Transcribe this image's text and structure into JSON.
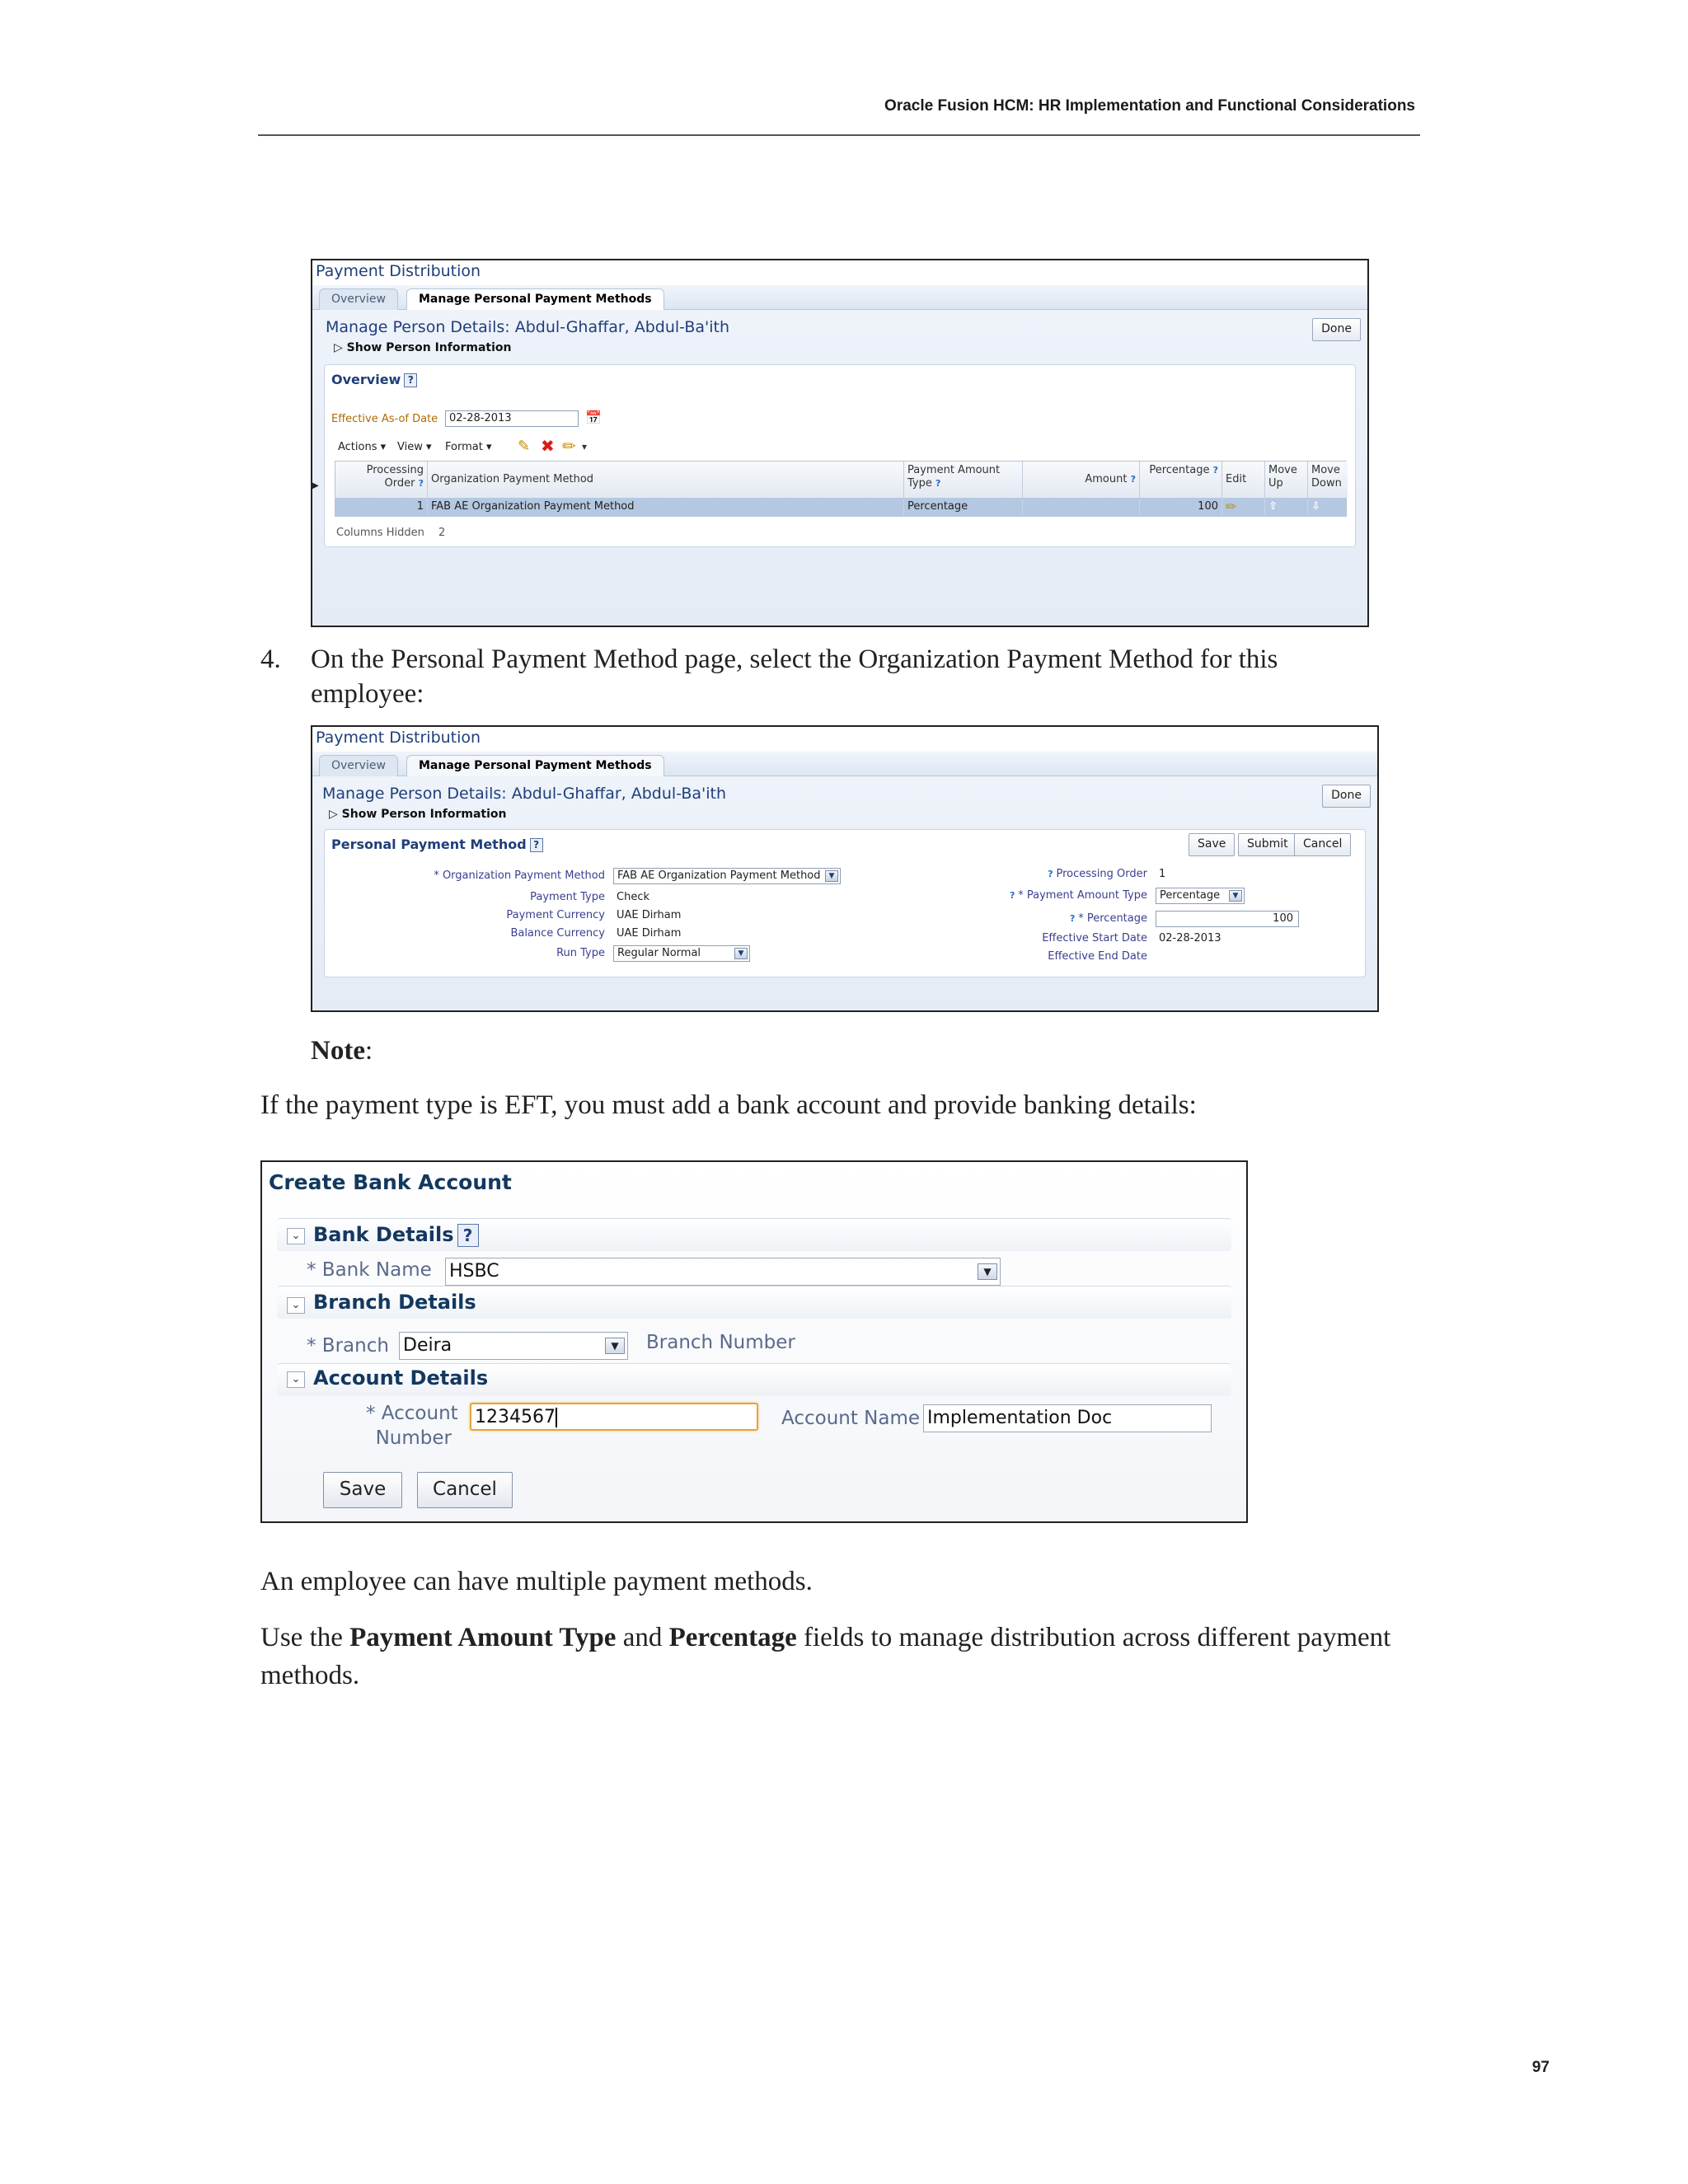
{
  "header": {
    "title": "Oracle Fusion HCM: HR Implementation and Functional Considerations"
  },
  "page_number": "97",
  "shot1": {
    "app_title": "Payment Distribution",
    "tabs": [
      "Overview",
      "Manage Personal Payment Methods"
    ],
    "heading": "Manage Person Details: Abdul-Ghaffar, Abdul-Ba'ith",
    "show_person": "Show Person Information",
    "done": "Done",
    "panel_title": "Overview",
    "effective_label": "Effective As-of Date",
    "effective_value": "02-28-2013",
    "menus": [
      "Actions",
      "View",
      "Format"
    ],
    "columns": [
      "Processing Order",
      "Organization Payment Method",
      "Payment Amount Type",
      "Amount",
      "Percentage",
      "Edit",
      "Move Up",
      "Move Down"
    ],
    "row": {
      "order": "1",
      "method": "FAB AE Organization Payment Method",
      "type": "Percentage",
      "amount": "",
      "percentage": "100"
    },
    "columns_hidden_label": "Columns Hidden",
    "columns_hidden_value": "2"
  },
  "step": {
    "number": "4.",
    "text": "On the Personal Payment Method page, select the Organization Payment Method for this employee:"
  },
  "shot2": {
    "app_title": "Payment Distribution",
    "tabs": [
      "Overview",
      "Manage Personal Payment Methods"
    ],
    "heading": "Manage Person Details: Abdul-Ghaffar, Abdul-Ba'ith",
    "show_person": "Show Person Information",
    "done": "Done",
    "panel_title": "Personal Payment Method",
    "buttons": [
      "Save",
      "Submit",
      "Cancel"
    ],
    "left_fields": [
      {
        "label": "* Organization Payment Method",
        "value": "FAB AE Organization Payment Method"
      },
      {
        "label": "Payment Type",
        "value": "Check"
      },
      {
        "label": "Payment Currency",
        "value": "UAE Dirham"
      },
      {
        "label": "Balance Currency",
        "value": "UAE Dirham"
      },
      {
        "label": "Run Type",
        "value": "Regular Normal"
      }
    ],
    "right_fields": [
      {
        "label": "Processing Order",
        "value": "1"
      },
      {
        "label": "* Payment Amount Type",
        "value": "Percentage"
      },
      {
        "label": "* Percentage",
        "value": "100"
      },
      {
        "label": "Effective Start Date",
        "value": "02-28-2013"
      },
      {
        "label": "Effective End Date",
        "value": ""
      }
    ]
  },
  "note": {
    "label": "Note",
    "text": "If the payment type is EFT, you must add a bank account and provide banking details:"
  },
  "shot3": {
    "title": "Create Bank Account",
    "bank_details": {
      "title": "Bank Details",
      "bank_name_label": "* Bank Name",
      "bank_name_value": "HSBC"
    },
    "branch_details": {
      "title": "Branch Details",
      "branch_label": "* Branch",
      "branch_value": "Deira",
      "branch_number_label": "Branch Number"
    },
    "account_details": {
      "title": "Account Details",
      "account_number_label_1": "* Account",
      "account_number_label_2": "Number",
      "account_number_value": "1234567",
      "account_name_label": "Account Name",
      "account_name_value": "Implementation Doc"
    },
    "save": "Save",
    "cancel": "Cancel"
  },
  "para1": "An employee can have multiple payment methods.",
  "para2": {
    "prefix": "Use the ",
    "bold1": "Payment Amount Type",
    "mid": " and ",
    "bold2": "Percentage",
    "suffix": " fields to manage distribution across different payment methods."
  },
  "colors": {
    "oracle_blue": "#1f3f7a",
    "row_selected": "#b5c8e2"
  }
}
